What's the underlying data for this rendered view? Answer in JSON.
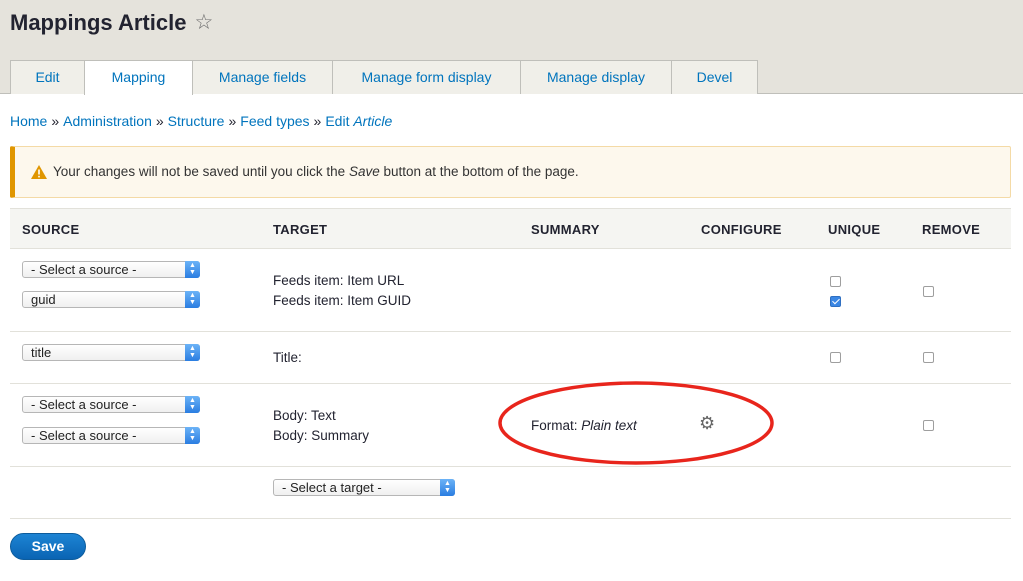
{
  "header": {
    "title": "Mappings Article",
    "star_icon": "☆"
  },
  "tabs": [
    {
      "label": "Edit"
    },
    {
      "label": "Mapping",
      "active": true
    },
    {
      "label": "Manage fields"
    },
    {
      "label": "Manage form display"
    },
    {
      "label": "Manage display"
    },
    {
      "label": "Devel"
    }
  ],
  "breadcrumb": {
    "items": [
      "Home",
      "Administration",
      "Structure",
      "Feed types",
      "Edit"
    ],
    "separator": "»",
    "last_italic": "Article"
  },
  "warning": {
    "icon": "warning-icon",
    "text_before": "Your changes will not be saved until you click the ",
    "text_em": "Save",
    "text_after": " button at the bottom of the page."
  },
  "table": {
    "headers": {
      "source": "SOURCE",
      "target": "TARGET",
      "summary": "SUMMARY",
      "configure": "CONFIGURE",
      "unique": "UNIQUE",
      "remove": "REMOVE"
    },
    "rows": [
      {
        "sources": [
          "- Select a source -",
          "guid"
        ],
        "targets": [
          "Feeds item: Item URL",
          "Feeds item: Item GUID"
        ],
        "unique": [
          false,
          true
        ],
        "remove": false
      },
      {
        "sources": [
          "title"
        ],
        "targets": [
          "Title:"
        ],
        "unique": [
          false
        ],
        "remove": false
      },
      {
        "sources": [
          "- Select a source -",
          "- Select a source -"
        ],
        "targets": [
          "Body: Text",
          "Body: Summary"
        ],
        "summary_label": "Format: ",
        "summary_value": "Plain text",
        "configure_icon": "gear-icon",
        "remove": false
      }
    ],
    "add_target": {
      "value": "- Select a target -"
    }
  },
  "actions": {
    "save_label": "Save"
  },
  "colors": {
    "link": "#0074bd",
    "annotation": "#e8251c",
    "warning_border": "#e09600",
    "primary_button": "#0a64b3"
  }
}
